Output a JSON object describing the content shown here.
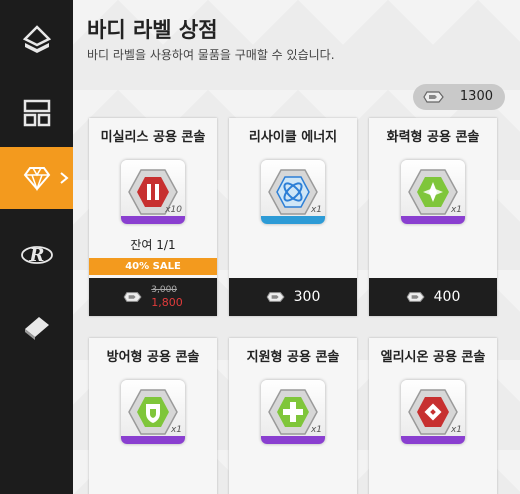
{
  "sidebar": {
    "items": [
      {
        "icon": "stacked-diamond-icon"
      },
      {
        "icon": "shop-icon"
      },
      {
        "icon": "gem-icon",
        "active": true
      },
      {
        "icon": "r-logo-icon"
      },
      {
        "icon": "eraser-icon"
      }
    ]
  },
  "header": {
    "title": "바디 라벨 상점",
    "subtitle": "바디 라벨을 사용하여 물품을 구매할 수 있습니다."
  },
  "currency": {
    "icon": "body-label-icon",
    "amount": "1300"
  },
  "colors": {
    "accent": "#f39a1e",
    "sale_price": "#e23b3b",
    "rarity_purple": "#8a3fd0"
  },
  "cards": [
    {
      "name": "미실리스 공용 콘솔",
      "quantity": "x10",
      "item_color": "#c73030",
      "bar_color": "#8a3fd0",
      "stock": "잔여 1/1",
      "sale_label": "40% SALE",
      "old_price": "3,000",
      "price": "1,800"
    },
    {
      "name": "리사이클 에너지",
      "quantity": "x1",
      "item_color": "#2d7fd6",
      "bar_color": "#2d9bd6",
      "price": "300"
    },
    {
      "name": "화력형 공용 콘솔",
      "quantity": "x1",
      "item_color": "#7fc63a",
      "bar_color": "#8a3fd0",
      "price": "400"
    },
    {
      "name": "방어형 공용 콘솔",
      "quantity": "x1",
      "item_color": "#7fc63a",
      "bar_color": "#8a3fd0"
    },
    {
      "name": "지원형 공용 콘솔",
      "quantity": "x1",
      "item_color": "#7fc63a",
      "bar_color": "#8a3fd0"
    },
    {
      "name": "엘리시온 공용 콘솔",
      "quantity": "x1",
      "item_color": "#c73030",
      "bar_color": "#8a3fd0"
    }
  ]
}
